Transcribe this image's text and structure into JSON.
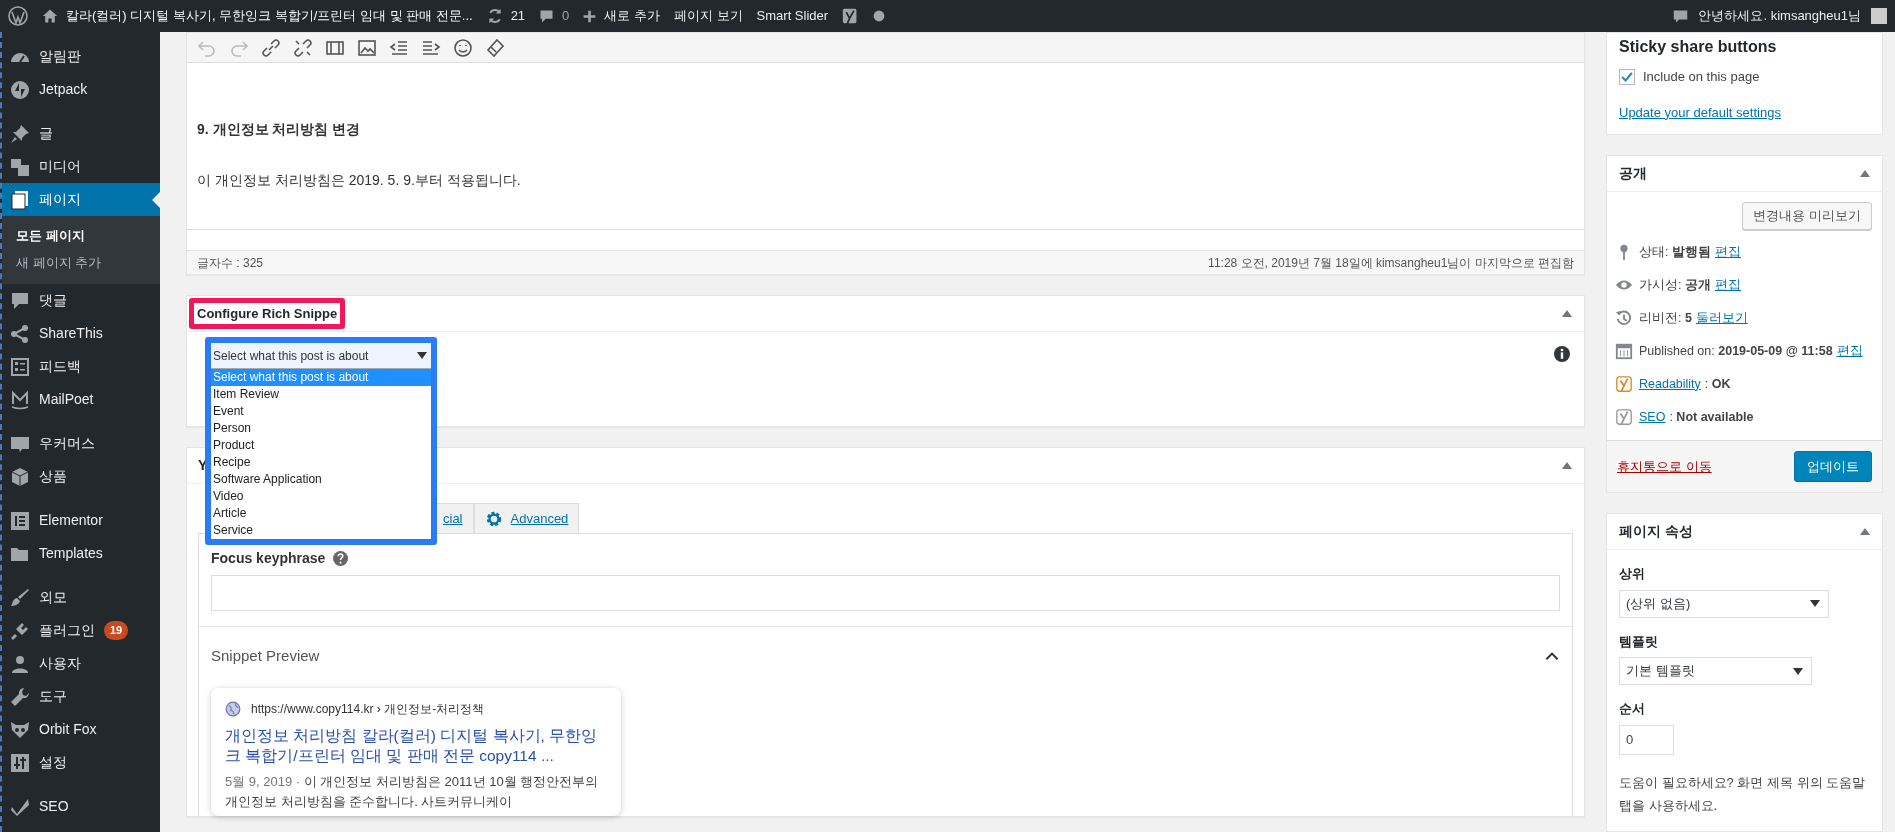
{
  "admin_bar": {
    "site_title": "칼라(컬러) 디지털 복사기, 무한잉크 복합기/프린터 임대 및 판매 전문...",
    "updates": "21",
    "comments": "0",
    "new_label": "새로 추가",
    "links": [
      "페이지 보기",
      "Smart Slider"
    ],
    "greeting": "안녕하세요. kimsangheu1님"
  },
  "sidebar": {
    "groups": [
      {
        "items": [
          {
            "kind": "dashboard",
            "label": "알림판",
            "selected": false
          },
          {
            "kind": "jetpack",
            "label": "Jetpack",
            "selected": false
          }
        ]
      },
      {
        "items": [
          {
            "kind": "posts",
            "label": "글",
            "selected": false
          },
          {
            "kind": "media",
            "label": "미디어",
            "selected": false
          },
          {
            "kind": "pages",
            "label": "페이지",
            "selected": true,
            "children": [
              {
                "label": "모든 페이지",
                "selected": true
              },
              {
                "label": "새 페이지 추가",
                "selected": false
              }
            ]
          },
          {
            "kind": "comments",
            "label": "댓글",
            "selected": false
          },
          {
            "kind": "share",
            "label": "ShareThis",
            "selected": false
          },
          {
            "kind": "feedback",
            "label": "피드백",
            "selected": false
          },
          {
            "kind": "mail",
            "label": "MailPoet",
            "selected": false
          }
        ]
      },
      {
        "items": [
          {
            "kind": "woo",
            "label": "우커머스",
            "selected": false
          },
          {
            "kind": "product",
            "label": "상품",
            "selected": false
          }
        ]
      },
      {
        "items": [
          {
            "kind": "elementor",
            "label": "Elementor",
            "selected": false
          },
          {
            "kind": "templates",
            "label": "Templates",
            "selected": false
          }
        ]
      },
      {
        "items": [
          {
            "kind": "appearance",
            "label": "외모",
            "selected": false
          },
          {
            "kind": "plugins",
            "label": "플러그인",
            "badge": "19",
            "selected": false
          },
          {
            "kind": "users",
            "label": "사용자",
            "selected": false
          },
          {
            "kind": "tools",
            "label": "도구",
            "selected": false
          },
          {
            "kind": "fox",
            "label": "Orbit Fox",
            "selected": false
          },
          {
            "kind": "settings",
            "label": "설정",
            "selected": false
          }
        ]
      },
      {
        "items": [
          {
            "kind": "seo",
            "label": "SEO",
            "selected": false
          }
        ]
      }
    ]
  },
  "editor": {
    "toolbar": [
      {
        "kind": "undo",
        "disabled": true
      },
      {
        "kind": "redo",
        "disabled": true
      },
      {
        "kind": "link",
        "disabled": false
      },
      {
        "kind": "unlink",
        "disabled": false
      },
      {
        "kind": "film",
        "disabled": false
      },
      {
        "kind": "image",
        "disabled": false
      },
      {
        "kind": "outdent",
        "disabled": false
      },
      {
        "kind": "indent",
        "disabled": false
      },
      {
        "kind": "emoji",
        "disabled": false
      },
      {
        "kind": "eraser",
        "disabled": false
      }
    ],
    "heading": "9. 개인정보 처리방침 변경",
    "paragraph": "이 개인정보 처리방침은 2019. 5. 9.부터 적용됩니다.",
    "word_count": "글자수 : 325",
    "last_edited": "11:28 오전, 2019년 7월 18일에 kimsangheu1님이 마지막으로 편집함"
  },
  "rich_snippet": {
    "title": "Configure Rich Snippe",
    "select": {
      "value": "Select what this post is about",
      "expanded": true,
      "options": [
        {
          "label": "Select what this post is about",
          "selected": true
        },
        {
          "label": "Item Review",
          "selected": false
        },
        {
          "label": "Event",
          "selected": false
        },
        {
          "label": "Person",
          "selected": false
        },
        {
          "label": "Product",
          "selected": false
        },
        {
          "label": "Recipe",
          "selected": false
        },
        {
          "label": "Software Application",
          "selected": false
        },
        {
          "label": "Video",
          "selected": false
        },
        {
          "label": "Article",
          "selected": false
        },
        {
          "label": "Service",
          "selected": false
        }
      ]
    }
  },
  "yoast": {
    "title": "Y",
    "tabs": [
      {
        "kind": "plain",
        "label": "cial",
        "selected": false
      },
      {
        "kind": "gear",
        "label": "Advanced",
        "selected": false
      }
    ],
    "focus_label": "Focus keyphrase",
    "snippet_title": "Snippet Preview",
    "snippet": {
      "url": "https://www.copy114.kr › 개인정보-처리정책",
      "title": "개인정보 처리방침 칼라(컬러) 디지털 복사기, 무한잉크 복합기/프린터 임대 및 판매 전문 copy114 ...",
      "date": "5월 9, 2019 · ",
      "description": "이 개인정보 처리방침은 2011년 10월 행정안전부의 개인정보 처리방침을 준수합니다. 사트커뮤니케이"
    }
  },
  "sticky_share": {
    "title": "Sticky share buttons",
    "include": {
      "label": "Include on this page",
      "checked": true
    },
    "link": "Update your default settings"
  },
  "publish": {
    "title": "공개",
    "preview_button": "변경내용 미리보기",
    "rows": [
      {
        "kind": "status",
        "parts": [
          {
            "kind": "text",
            "text": "상태: **발행됨**"
          },
          {
            "kind": "link",
            "text": "편집"
          }
        ]
      },
      {
        "kind": "visibility",
        "parts": [
          {
            "kind": "text",
            "text": "가시성: **공개**"
          },
          {
            "kind": "link",
            "text": "편집"
          }
        ]
      },
      {
        "kind": "revision",
        "parts": [
          {
            "kind": "text",
            "text": "리비전: **5**"
          },
          {
            "kind": "link",
            "text": "둘러보기"
          }
        ]
      },
      {
        "kind": "calendar",
        "parts": [
          {
            "kind": "text",
            "text": "Published on: **2019-05-09 @ 11:58**"
          },
          {
            "kind": "link",
            "text": "편집"
          }
        ]
      },
      {
        "kind": "readability",
        "parts": [
          {
            "kind": "link",
            "text": "Readability"
          },
          {
            "kind": "text",
            "text": ": **OK**"
          }
        ]
      },
      {
        "kind": "seo",
        "parts": [
          {
            "kind": "link",
            "text": "SEO"
          },
          {
            "kind": "text",
            "text": ": **Not available**"
          }
        ]
      }
    ],
    "trash_link": "휴지통으로 이동",
    "update_button": "업데이트"
  },
  "page_attributes": {
    "title": "페이지 속성",
    "parent": {
      "label": "상위",
      "value": "(상위 없음)"
    },
    "template": {
      "label": "템플릿",
      "value": "기본 템플릿"
    },
    "order": {
      "label": "순서",
      "value": "0"
    },
    "help": "도움이 필요하세요? 화면 제목 위의 도움말 탭을 사용하세요."
  }
}
